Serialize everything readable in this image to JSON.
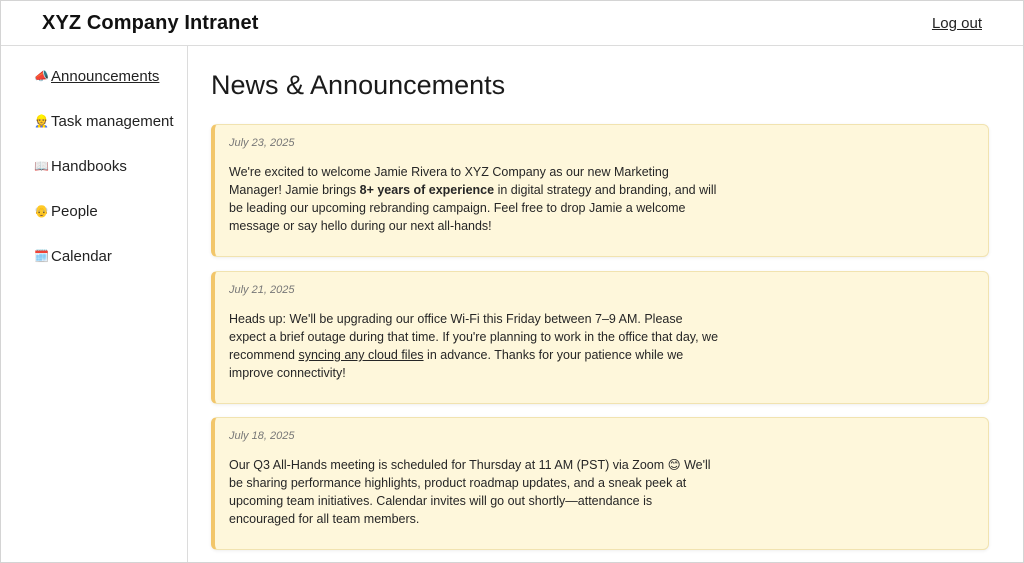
{
  "header": {
    "title": "XYZ Company Intranet",
    "logout_label": "Log out"
  },
  "sidebar": {
    "items": [
      {
        "icon": "📣",
        "label": "Announcements",
        "active": true
      },
      {
        "icon": "👷",
        "label": "Task management"
      },
      {
        "icon": "📖",
        "label": "Handbooks"
      },
      {
        "icon": "👴",
        "label": "People"
      },
      {
        "icon": "🗓️",
        "label": "Calendar"
      }
    ]
  },
  "main": {
    "title": "News & Announcements",
    "posts": [
      {
        "date": "July 23, 2025",
        "text_1": "We're excited to welcome Jamie Rivera to XYZ Company as our new Marketing Manager! Jamie brings ",
        "bold": "8+ years of experience",
        "text_2": " in digital strategy and branding, and will be leading our upcoming rebranding campaign. Feel free to drop Jamie a welcome message or say hello during our next all-hands!"
      },
      {
        "date": "July 21, 2025",
        "text_1": "Heads up: We'll be upgrading our office Wi-Fi this Friday between 7–9 AM. Please expect a brief outage during that time. If you're planning to work in the office that day, we recommend ",
        "link": "syncing any cloud files",
        "text_2": " in advance. Thanks for your patience while we improve connectivity!"
      },
      {
        "date": "July 18, 2025",
        "text_1": "Our Q3 All-Hands meeting is scheduled for Thursday at 11 AM (PST) via Zoom 😊 We'll be sharing performance highlights, product roadmap updates, and a sneak peek at upcoming team initiatives. Calendar invites will go out shortly—attendance is encouraged for all team members."
      }
    ]
  }
}
